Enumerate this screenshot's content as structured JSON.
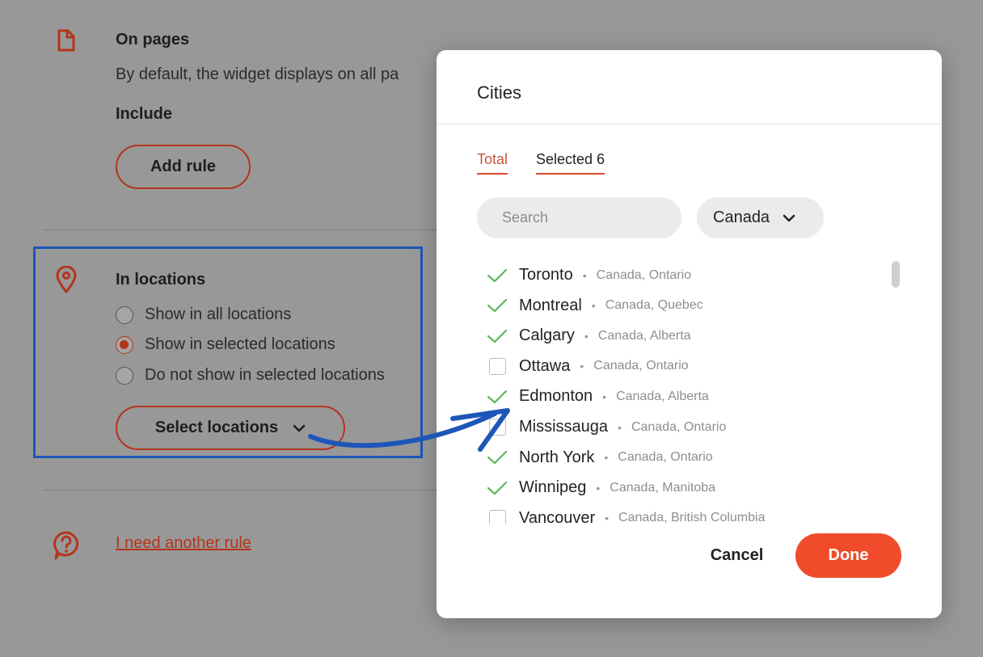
{
  "settings": {
    "on_pages": {
      "heading": "On pages",
      "description": "By default, the widget displays on all pa",
      "include_label": "Include",
      "add_rule_label": "Add rule",
      "icon": "document-icon"
    },
    "in_locations": {
      "heading": "In locations",
      "icon": "location-pin-icon",
      "options": [
        {
          "label": "Show in all locations",
          "selected": false
        },
        {
          "label": "Show in selected locations",
          "selected": true
        },
        {
          "label": "Do not show in selected locations",
          "selected": false
        }
      ],
      "select_locations_label": "Select locations"
    },
    "help": {
      "link_label": "I need another rule",
      "icon": "question-bubble-icon"
    }
  },
  "modal": {
    "title": "Cities",
    "tabs": [
      {
        "label": "Total",
        "active": true
      },
      {
        "label": "Selected 6",
        "active": false
      }
    ],
    "search_placeholder": "Search",
    "country": "Canada",
    "cities": [
      {
        "name": "Toronto",
        "region": "Canada, Ontario",
        "checked": true
      },
      {
        "name": "Montreal",
        "region": "Canada, Quebec",
        "checked": true
      },
      {
        "name": "Calgary",
        "region": "Canada, Alberta",
        "checked": true
      },
      {
        "name": "Ottawa",
        "region": "Canada, Ontario",
        "checked": false
      },
      {
        "name": "Edmonton",
        "region": "Canada, Alberta",
        "checked": true
      },
      {
        "name": "Mississauga",
        "region": "Canada, Ontario",
        "checked": false
      },
      {
        "name": "North York",
        "region": "Canada, Ontario",
        "checked": true
      },
      {
        "name": "Winnipeg",
        "region": "Canada, Manitoba",
        "checked": true
      },
      {
        "name": "Vancouver",
        "region": "Canada, British Columbia",
        "checked": false
      }
    ],
    "cancel_label": "Cancel",
    "done_label": "Done"
  },
  "colors": {
    "accent": "#f04c2b",
    "check": "#5cb85c",
    "highlight": "#1d56b8",
    "overlay": "#989898"
  }
}
